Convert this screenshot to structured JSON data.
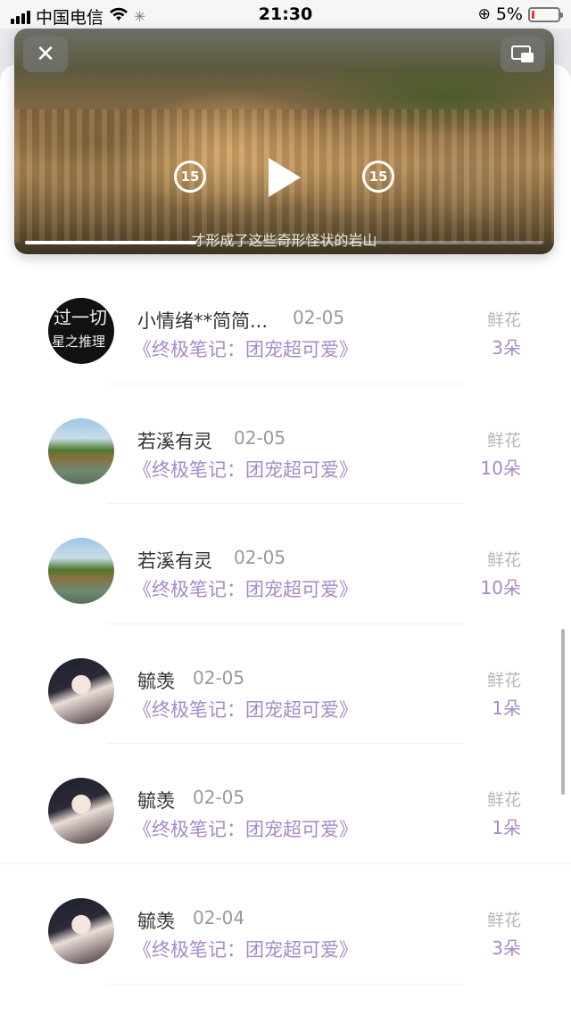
{
  "status_bar": {
    "carrier": "中国电信",
    "time": "21:30",
    "battery": "5%"
  },
  "video": {
    "subtitle": "才形成了这些奇形怪状的岩山",
    "skip_back": "15",
    "skip_forward": "15",
    "progress": 0.33
  },
  "rows": [
    {
      "name": "小情绪**简简...",
      "date": "02-05",
      "book": "《终极笔记：团宠超可爱》",
      "gift_label": "鲜花",
      "gift_count": "3朵",
      "avatar": "text"
    },
    {
      "name": "若溪有灵",
      "date": "02-05",
      "book": "《终极笔记：团宠超可爱》",
      "gift_label": "鲜花",
      "gift_count": "10朵",
      "avatar": "lake"
    },
    {
      "name": "若溪有灵",
      "date": "02-05",
      "book": "《终极笔记：团宠超可爱》",
      "gift_label": "鲜花",
      "gift_count": "10朵",
      "avatar": "lake"
    },
    {
      "name": "毓羡",
      "date": "02-05",
      "book": "《终极笔记：团宠超可爱》",
      "gift_label": "鲜花",
      "gift_count": "1朵",
      "avatar": "girl"
    },
    {
      "name": "毓羡",
      "date": "02-05",
      "book": "《终极笔记：团宠超可爱》",
      "gift_label": "鲜花",
      "gift_count": "1朵",
      "avatar": "girl"
    },
    {
      "name": "毓羡",
      "date": "02-04",
      "book": "《终极笔记：团宠超可爱》",
      "gift_label": "鲜花",
      "gift_count": "3朵",
      "avatar": "girl"
    }
  ],
  "avatar_text": {
    "line1": "过一切",
    "line2": "星之推理"
  }
}
